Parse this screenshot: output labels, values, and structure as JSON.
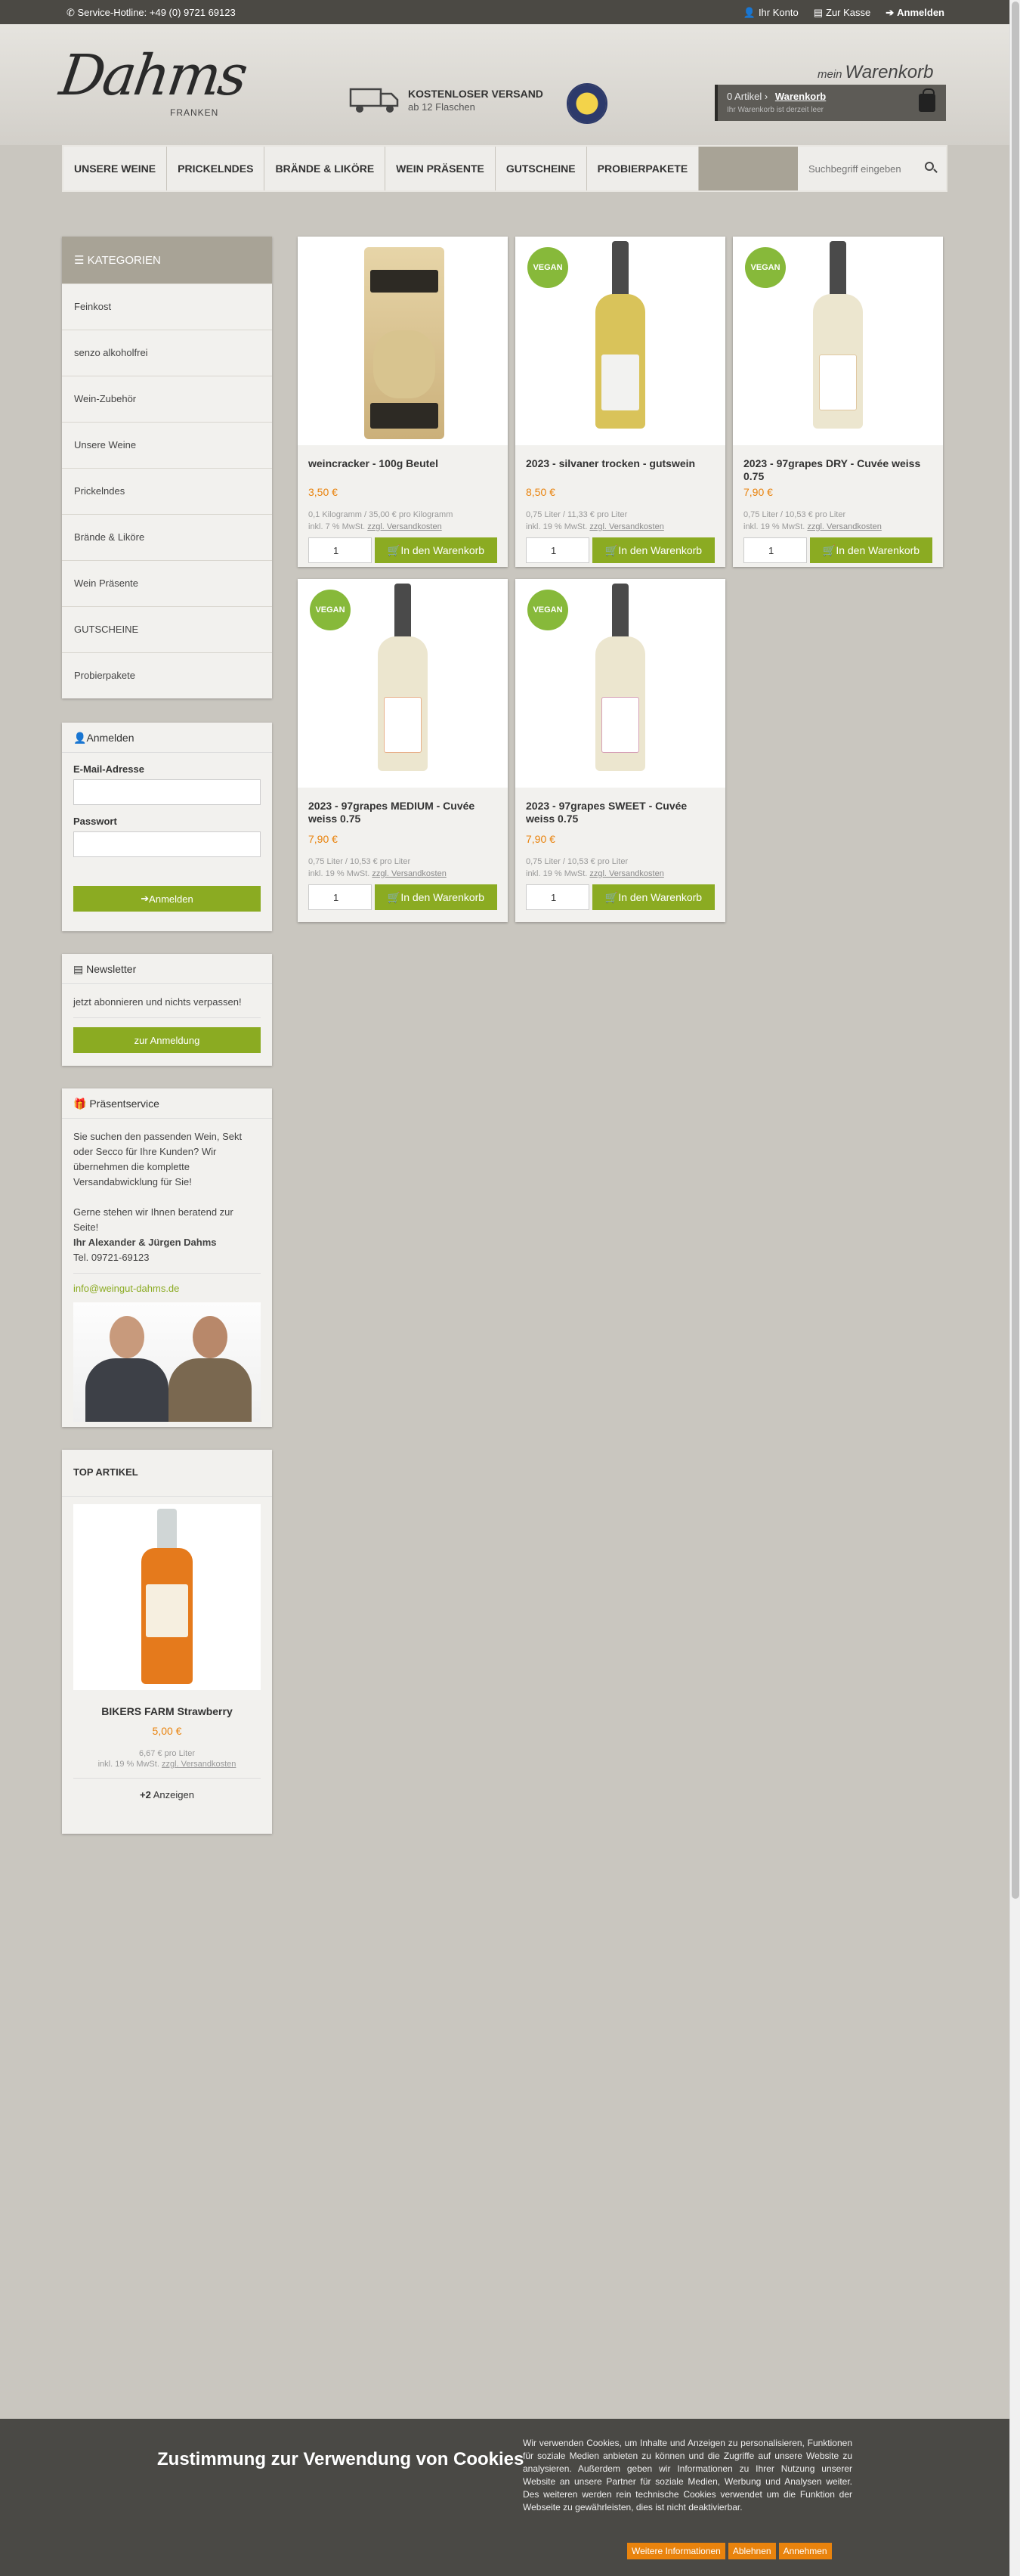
{
  "topbar": {
    "hotline": "Service-Hotline: +49 (0) 9721 69123",
    "account": "Ihr Konto",
    "checkout": "Zur Kasse",
    "login": "Anmelden"
  },
  "header": {
    "logo": "Dahms",
    "logo_sub": "FRANKEN",
    "shipping_title": "KOSTENLOSER VERSAND",
    "shipping_sub": "ab 12 Flaschen",
    "cart_title_small": "mein",
    "cart_title": "Warenkorb",
    "cart_count": "0 Artikel",
    "cart_link": "Warenkorb",
    "cart_note": "Ihr Warenkorb ist derzeit leer"
  },
  "nav": {
    "items": [
      "UNSERE WEINE",
      "PRICKELNDES",
      "BRÄNDE & LIKÖRE",
      "WEIN PRÄSENTE",
      "GUTSCHEINE",
      "PROBIERPAKETE"
    ],
    "search_placeholder": "Suchbegriff eingeben"
  },
  "categories": {
    "title": "KATEGORIEN",
    "items": [
      "Feinkost",
      "senzo alkoholfrei",
      "Wein-Zubehör",
      "Unsere Weine",
      "Prickelndes",
      "Brände & Liköre",
      "Wein Präsente",
      "GUTSCHEINE",
      "Probierpakete"
    ]
  },
  "login_box": {
    "title": "Anmelden",
    "email_label": "E-Mail-Adresse",
    "password_label": "Passwort",
    "button": "Anmelden"
  },
  "newsletter": {
    "title": "Newsletter",
    "text": "jetzt abonnieren und nichts verpassen!",
    "button": "zur Anmeldung"
  },
  "present": {
    "title": "Präsentservice",
    "text1": "Sie suchen den passenden Wein, Sekt oder Secco für Ihre Kunden? Wir übernehmen die komplette Versandabwicklung für Sie!",
    "text2": "Gerne stehen wir Ihnen beratend zur Seite!",
    "names": "Ihr Alexander & Jürgen Dahms",
    "phone": "Tel. 09721-69123",
    "email": "info@weingut-dahms.de"
  },
  "top_articles": {
    "title": "TOP ARTIKEL",
    "name": "BIKERS FARM Strawberry",
    "price": "5,00 €",
    "unit": "6,67 € pro Liter",
    "tax": "inkl. 19 % MwSt.",
    "shipping": "zzgl. Versandkosten",
    "more": "Anzeigen",
    "more_count": "+2"
  },
  "products": [
    {
      "name": "weincracker - 100g Beutel",
      "price": "3,50 €",
      "unit": "0,1 Kilogramm / 35,00 € pro Kilogramm",
      "tax": "inkl. 7 % MwSt.",
      "shipping": "zzgl. Versandkosten",
      "qty": "1",
      "button": "In den Warenkorb"
    },
    {
      "name": "2023 - silvaner trocken - gutswein",
      "price": "8,50 €",
      "unit": "0,75 Liter / 11,33 € pro Liter",
      "tax": "inkl. 19 % MwSt.",
      "shipping": "zzgl. Versandkosten",
      "qty": "1",
      "button": "In den Warenkorb",
      "badge": "VEGAN"
    },
    {
      "name": "2023 - 97grapes DRY - Cuvée weiss 0.75",
      "price": "7,90 €",
      "unit": "0,75 Liter / 10,53 € pro Liter",
      "tax": "inkl. 19 % MwSt.",
      "shipping": "zzgl. Versandkosten",
      "qty": "1",
      "button": "In den Warenkorb",
      "badge": "VEGAN"
    },
    {
      "name": "2023 - 97grapes MEDIUM - Cuvée weiss 0.75",
      "price": "7,90 €",
      "unit": "0,75 Liter / 10,53 € pro Liter",
      "tax": "inkl. 19 % MwSt.",
      "shipping": "zzgl. Versandkosten",
      "qty": "1",
      "button": "In den Warenkorb",
      "badge": "VEGAN"
    },
    {
      "name": "2023 - 97grapes SWEET - Cuvée weiss 0.75",
      "price": "7,90 €",
      "unit": "0,75 Liter / 10,53 € pro Liter",
      "tax": "inkl. 19 % MwSt.",
      "shipping": "zzgl. Versandkosten",
      "qty": "1",
      "button": "In den Warenkorb",
      "badge": "VEGAN"
    }
  ],
  "cookie": {
    "title": "Zustimmung zur Verwendung von Cookies",
    "text": "Wir verwenden Cookies, um Inhalte und Anzeigen zu personalisieren, Funktionen für soziale Medien anbieten zu können und die Zugriffe auf unsere Website zu analysieren. Außerdem geben wir Informationen zu Ihrer Nutzung unserer Website an unsere Partner für soziale Medien, Werbung und Analysen weiter. Des weiteren werden rein technische Cookies verwendet um die Funktion der Webseite zu gewährleisten, dies ist nicht deaktivierbar.",
    "more": "Weitere Informationen",
    "decline": "Ablehnen",
    "accept": "Annehmen"
  },
  "colors": {
    "accent_green": "#8bab22",
    "price_orange": "#e9830d",
    "topbar": "#4b4944",
    "category_header": "#a8a396"
  }
}
